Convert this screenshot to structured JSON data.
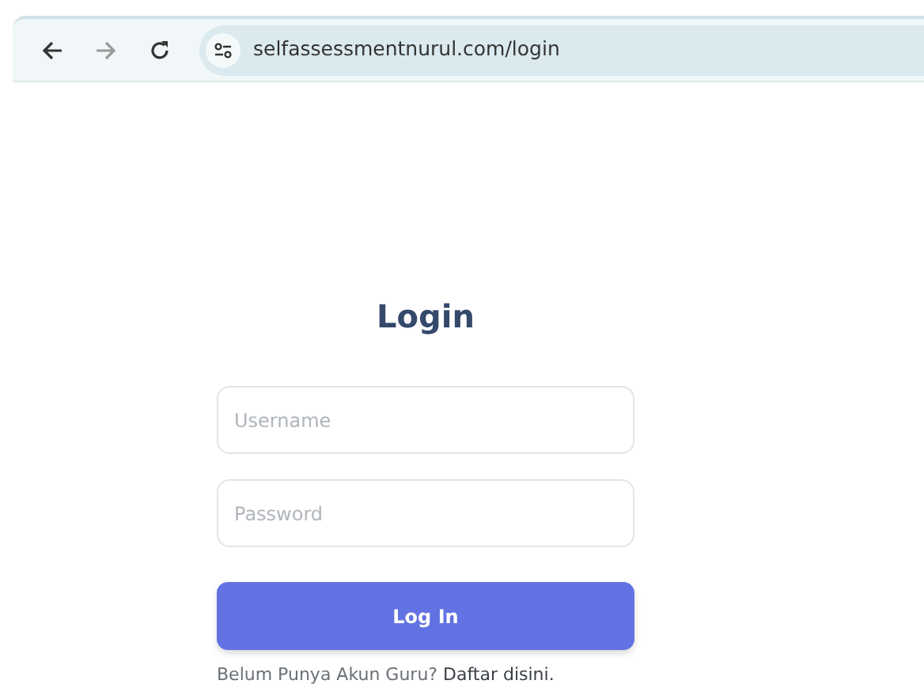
{
  "browser": {
    "url": "selfassessmentnurul.com/login"
  },
  "form": {
    "title": "Login",
    "fields": [
      {
        "placeholder": "Username"
      },
      {
        "placeholder": "Password"
      }
    ],
    "submit": "Log In",
    "footer": {
      "text": "Belum Punya Akun Guru?",
      "link": "Daftar disini."
    }
  }
}
